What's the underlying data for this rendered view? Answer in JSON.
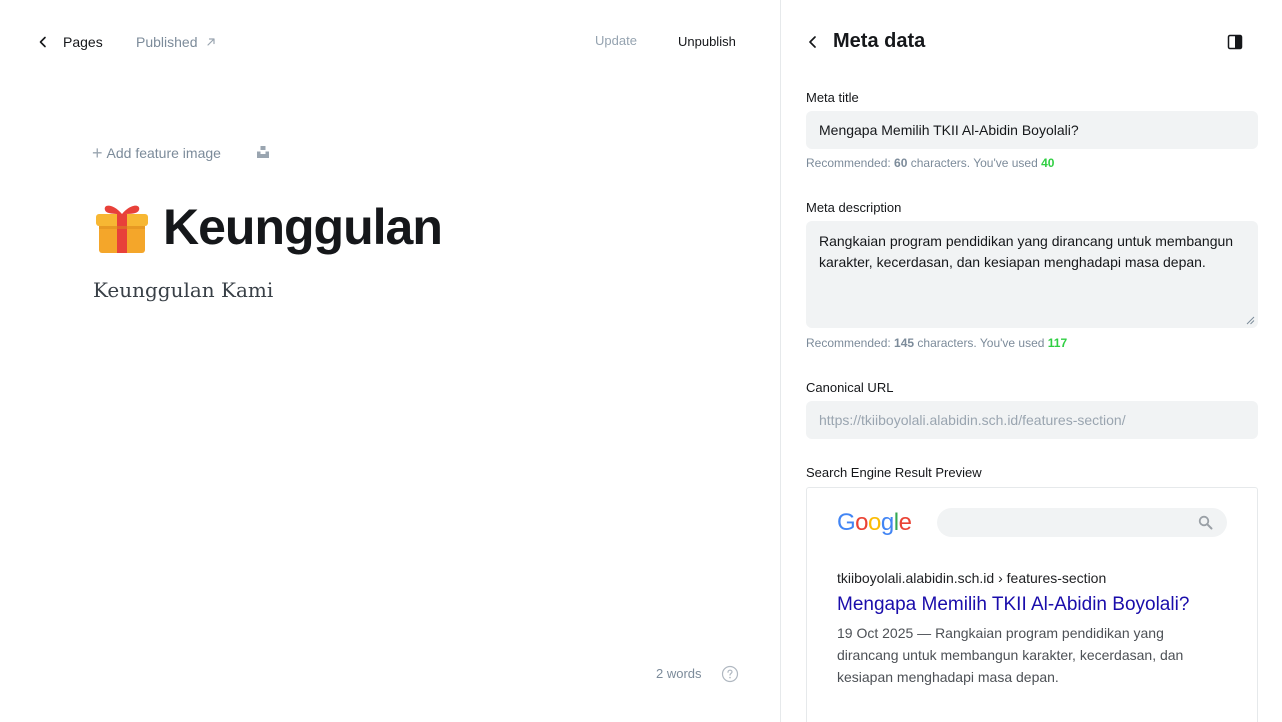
{
  "topbar": {
    "back_label": "Pages",
    "status_label": "Published",
    "update_label": "Update",
    "unpublish_label": "Unpublish"
  },
  "editor": {
    "add_feature_image_label": "Add feature image",
    "title_text": "Keunggulan",
    "excerpt": "Keunggulan Kami",
    "word_count": "2 words"
  },
  "panel": {
    "title": "Meta data",
    "meta_title": {
      "label": "Meta title",
      "value": "Mengapa Memilih TKII Al-Abidin Boyolali?",
      "hint_prefix": "Recommended: ",
      "recommended": "60",
      "hint_middle": " characters. You've used ",
      "used": "40"
    },
    "meta_description": {
      "label": "Meta description",
      "value": "Rangkaian program pendidikan yang dirancang untuk membangun karakter, kecerdasan, dan kesiapan menghadapi masa depan.",
      "hint_prefix": "Recommended: ",
      "recommended": "145",
      "hint_middle": " characters. You've used ",
      "used": "117"
    },
    "canonical": {
      "label": "Canonical URL",
      "placeholder": "https://tkiiboyolali.alabidin.sch.id/features-section/"
    },
    "serp": {
      "label": "Search Engine Result Preview",
      "breadcrumb": "tkiiboyolali.alabidin.sch.id › features-section",
      "title": "Mengapa Memilih TKII Al-Abidin Boyolali?",
      "date": "19 Oct 2025",
      "dash": " — ",
      "description": "Rangkaian program pendidikan yang dirancang untuk membangun karakter, kecerdasan, dan kesiapan menghadapi masa depan."
    }
  },
  "colors": {
    "accent_green": "#30cf43",
    "serp_link": "#1a0dab",
    "input_bg": "#f1f3f4"
  },
  "icons": {
    "back": "chevron-left-icon",
    "external": "arrow-up-right-icon",
    "unsplash": "unsplash-icon",
    "emoji": "gift-emoji",
    "help": "question-circle-icon",
    "sidebar_toggle": "sidebar-toggle-icon",
    "search": "magnifier-icon"
  }
}
